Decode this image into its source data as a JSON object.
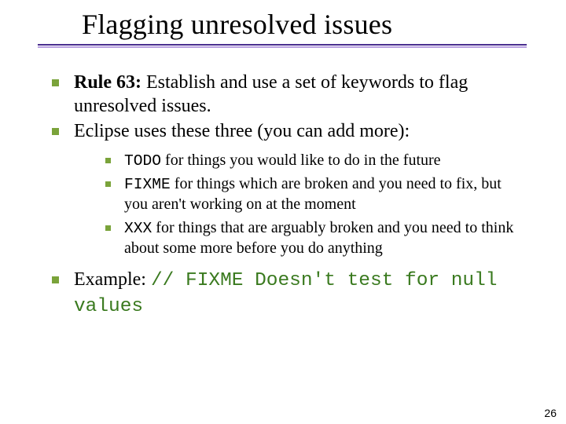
{
  "title": "Flagging unresolved issues",
  "bullets": {
    "b1_rule_prefix": "Rule 63:",
    "b1_rest": " Establish and use a set of keywords to flag unresolved issues.",
    "b2": "Eclipse uses these three (you can add more):",
    "sub": {
      "s1_code": "TODO",
      "s1_rest": " for things you would like to do in the future",
      "s2_code": "FIXME",
      "s2_rest": " for things which are broken and you need to fix, but you aren't working on at the moment",
      "s3_code": "XXX",
      "s3_rest": " for things that are arguably broken and you need to think about some more before you do anything"
    },
    "b3_label": "Example: ",
    "b3_code": "// FIXME  Doesn't test for null values"
  },
  "page_number": "26"
}
